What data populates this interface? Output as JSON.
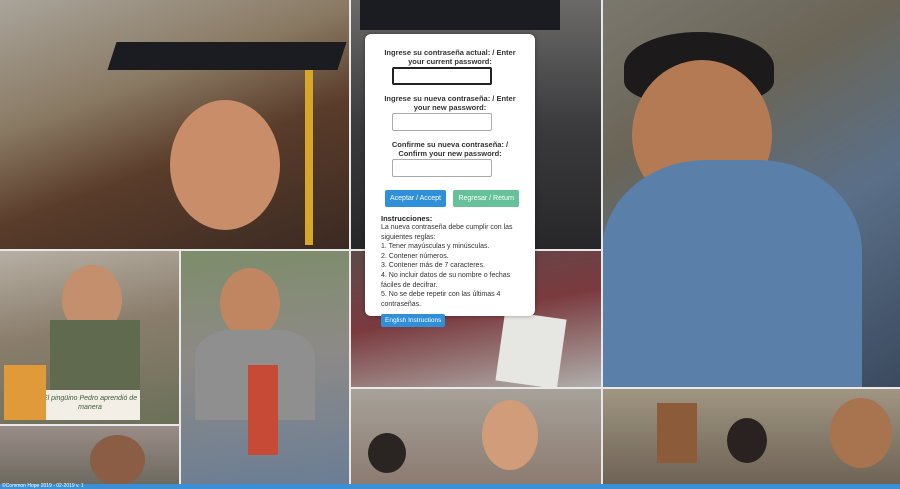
{
  "form": {
    "current_password_label": "Ingrese su contraseña actual: / Enter your current password:",
    "current_password_value": "",
    "new_password_label": "Ingrese su nueva contraseña: / Enter your new password:",
    "new_password_value": "",
    "confirm_password_label": "Confirme su nueva contraseña: / Confirm your new password:",
    "confirm_password_value": "",
    "accept_button": "Aceptar / Accept",
    "back_button": "Regresar / Return"
  },
  "instructions": {
    "title": "Instrucciones:",
    "intro": "La nueva contraseña debe cumplir con las siguientes reglas:",
    "rules": [
      "1. Tener mayúsculas y minúsculas.",
      "2. Contener números.",
      "3. Contener más de 7 caracteres.",
      "4. No incluir datos de su nombre o fechas fáciles de decifrar.",
      "5. No se debe repetir con las últimas 4 contraseñas."
    ],
    "english_button": "English Instructions"
  },
  "photos": {
    "sign_text": "El pingüino Pedro aprendió de manera"
  },
  "footer": {
    "text": "©Common Hope 2019 - 02-2019 v. 1"
  },
  "colors": {
    "accent": "#2f8fd8",
    "return_button": "#66c19a",
    "footer_bar": "#3a8fd6"
  }
}
